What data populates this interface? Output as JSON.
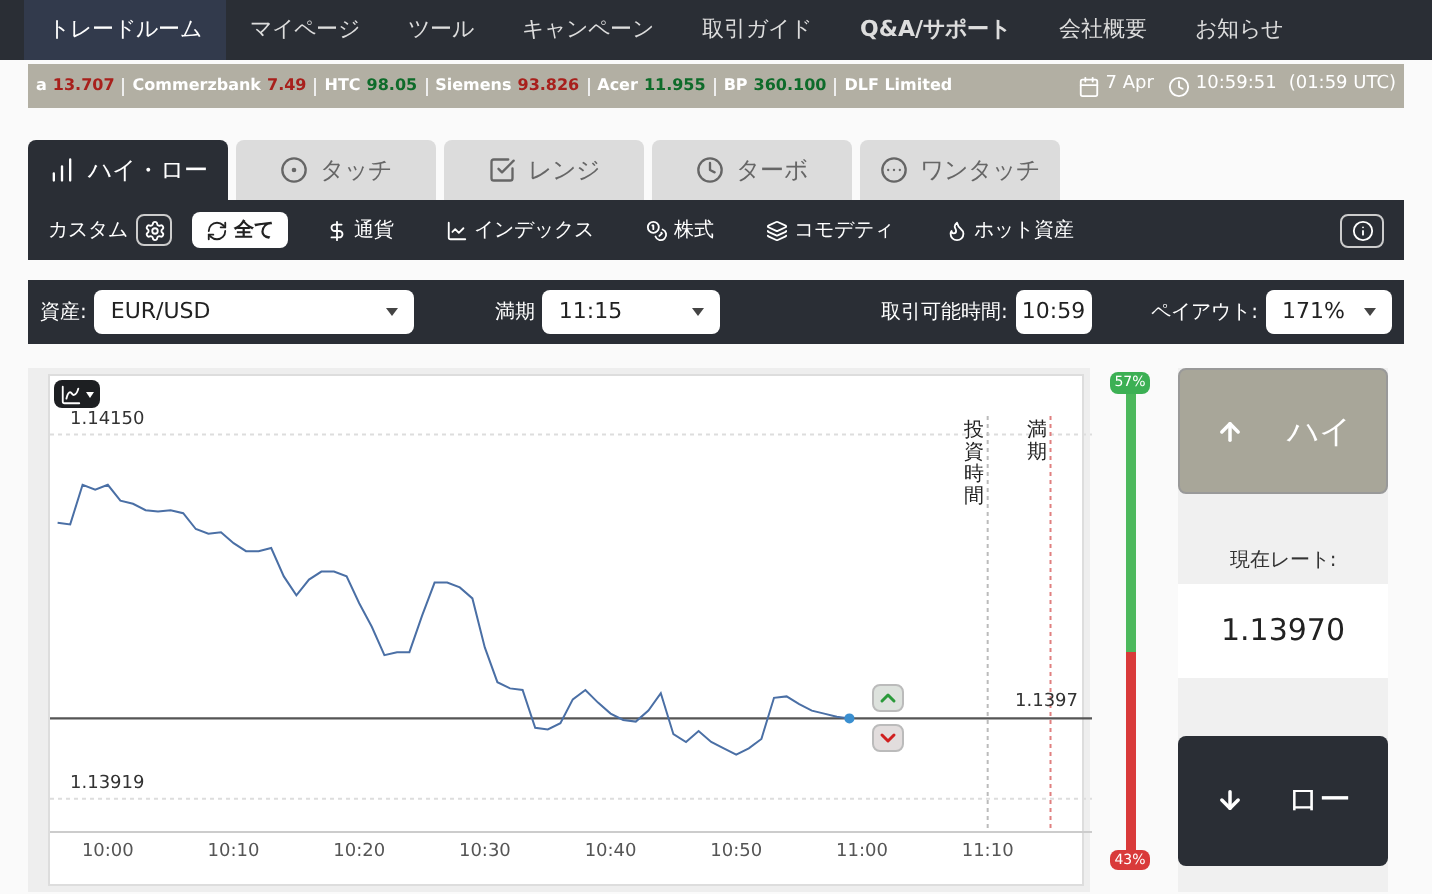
{
  "nav": [
    {
      "label": "トレードルーム",
      "selected": true
    },
    {
      "label": "マイページ",
      "selected": false
    },
    {
      "label": "ツール",
      "selected": false
    },
    {
      "label": "キャンペーン",
      "selected": false
    },
    {
      "label": "取引ガイド",
      "selected": false
    },
    {
      "label": "Q&A/サポート",
      "selected": false
    },
    {
      "label": "会社概要",
      "selected": false
    },
    {
      "label": "お知らせ",
      "selected": false
    }
  ],
  "ticker": [
    {
      "name": "a",
      "value": "13.707",
      "color": "#a8201c"
    },
    {
      "name": "Commerzbank",
      "value": "7.49",
      "color": "#a8201c"
    },
    {
      "name": "HTC",
      "value": "98.05",
      "color": "#0e6b2a"
    },
    {
      "name": "Siemens",
      "value": "93.826",
      "color": "#a8201c"
    },
    {
      "name": "Acer",
      "value": "11.955",
      "color": "#0e6b2a"
    },
    {
      "name": "BP",
      "value": "360.100",
      "color": "#0e6b2a"
    },
    {
      "name": "DLF Limited"
    }
  ],
  "date": "7 Apr",
  "time": "10:59:51",
  "utc": "(01:59 UTC)",
  "tabs": [
    {
      "label": "ハイ・ロー",
      "selected": true,
      "kind": "highlow"
    },
    {
      "label": "タッチ",
      "selected": false,
      "kind": "touch"
    },
    {
      "label": "レンジ",
      "selected": false,
      "kind": "range"
    },
    {
      "label": "ターボ",
      "selected": false,
      "kind": "turbo"
    },
    {
      "label": "ワンタッチ",
      "selected": false,
      "kind": "onetouch"
    }
  ],
  "filter": {
    "custom_label": "カスタム",
    "categories": [
      {
        "label": "全て",
        "selected": true,
        "kind": "all"
      },
      {
        "label": "通貨",
        "selected": false,
        "kind": "currency"
      },
      {
        "label": "インデックス",
        "selected": false,
        "kind": "index"
      },
      {
        "label": "株式",
        "selected": false,
        "kind": "stock"
      },
      {
        "label": "コモデティ",
        "selected": false,
        "kind": "commodity"
      },
      {
        "label": "ホット資産",
        "selected": false,
        "kind": "hot"
      }
    ]
  },
  "options": {
    "asset": {
      "label": "資産:",
      "value": "EUR/USD"
    },
    "expiry": {
      "label": "満期",
      "value": "11:15"
    },
    "trading_time": {
      "label": "取引可能時間:",
      "value": "10:59"
    },
    "payout": {
      "label": "ペイアウト:",
      "value": "171%"
    }
  },
  "chart": {
    "chart_data": {
      "type": "line",
      "categories": [
        null,
        null,
        null,
        null,
        "10:00",
        null,
        null,
        null,
        null,
        null,
        null,
        null,
        null,
        null,
        "10:10",
        null,
        null,
        null,
        null,
        null,
        null,
        null,
        null,
        null,
        "10:20",
        null,
        null,
        null,
        null,
        null,
        null,
        null,
        null,
        null,
        "10:30",
        null,
        null,
        null,
        null,
        null,
        null,
        null,
        null,
        null,
        "10:40",
        null,
        null,
        null,
        null,
        null,
        null,
        null,
        null,
        null,
        "10:50",
        null,
        null,
        null,
        null,
        null,
        null,
        null,
        null,
        null,
        "11:00",
        null,
        null,
        null,
        null,
        null,
        null,
        null,
        null,
        null,
        "11:10",
        null,
        null,
        null,
        null,
        null,
        null,
        null,
        null
      ],
      "series": [
        {
          "color": "#4a6fa5",
          "values": [
            1.14094,
            1.14093,
            1.14118,
            1.14115,
            1.14118,
            1.14108,
            1.14106,
            1.14102,
            1.14101,
            1.14102,
            1.141,
            1.1409,
            1.14087,
            1.14088,
            1.14081,
            1.14076,
            1.14076,
            1.14078,
            1.1406,
            1.14048,
            1.14058,
            1.14063,
            1.14063,
            1.1406,
            1.14043,
            1.14028,
            1.1401,
            1.14012,
            1.14012,
            1.14035,
            1.14056,
            1.14056,
            1.14053,
            1.14046,
            1.14015,
            1.13993,
            1.13989,
            1.13988,
            1.13964,
            1.13963,
            1.13967,
            1.13982,
            1.13988,
            1.1398,
            1.13973,
            1.13969,
            1.13968,
            1.13975,
            1.13986,
            1.1396,
            1.13955,
            1.13962,
            1.13955,
            1.13951,
            1.13947,
            1.13951,
            1.13957,
            1.13983,
            1.13984,
            1.13979,
            1.13975,
            1.13973,
            1.13971,
            1.1397,
            null,
            null,
            null,
            null,
            null,
            null,
            null,
            null,
            null,
            null,
            null,
            null,
            null,
            null,
            null,
            null,
            null,
            null,
            null
          ]
        }
      ],
      "ylim": [
        1.13898,
        1.14187
      ],
      "yticks": [
        {
          "value": 1.1415,
          "label": "1.14150"
        },
        {
          "value": 1.13919,
          "label": "1.13919"
        }
      ],
      "ref_lines": [
        {
          "axis": "y",
          "value": 1.1397
        }
      ],
      "annotations": [
        "1.1397",
        "投資時間",
        "満期"
      ]
    }
  },
  "sentiment": {
    "level": 0.57,
    "up_label": "57%",
    "down_label": "43%"
  },
  "high_button": "ハイ",
  "rate_label": "現在レート:",
  "rate": "1.13970",
  "low_button": "ロー"
}
